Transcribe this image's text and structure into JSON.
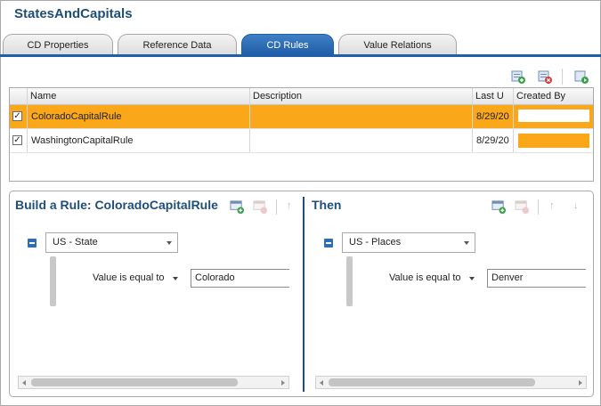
{
  "app": {
    "title": "StatesAndCapitals"
  },
  "tabs": [
    {
      "label": "CD Properties",
      "active": false
    },
    {
      "label": "Reference Data",
      "active": false
    },
    {
      "label": "CD Rules",
      "active": true
    },
    {
      "label": "Value Relations",
      "active": false
    }
  ],
  "toolbar": {
    "icons": [
      "add-rule-icon",
      "delete-rule-icon",
      "run-rule-icon"
    ]
  },
  "grid": {
    "columns": [
      "",
      "Name",
      "Description",
      "Last U",
      "Created By"
    ],
    "rows": [
      {
        "checked": true,
        "name": "ColoradoCapitalRule",
        "description": "",
        "last_updated": "8/29/20",
        "created_by": "",
        "selected": true
      },
      {
        "checked": true,
        "name": "WashingtonCapitalRule",
        "description": "",
        "last_updated": "8/29/20",
        "created_by": "",
        "selected": false
      }
    ]
  },
  "builder": {
    "left": {
      "title": "Build a Rule: ColoradoCapitalRule",
      "domain": "US - State",
      "operator": "Value is equal to",
      "value": "Colorado"
    },
    "right": {
      "title": "Then",
      "domain": "US - Places",
      "operator": "Value is equal to",
      "value": "Denver"
    },
    "icons": [
      "add-condition-icon",
      "remove-condition-icon",
      "move-up-icon",
      "move-down-icon"
    ]
  },
  "colors": {
    "accent": "#1f5ea8",
    "title": "#1f4e79",
    "selection": "#faa719"
  }
}
